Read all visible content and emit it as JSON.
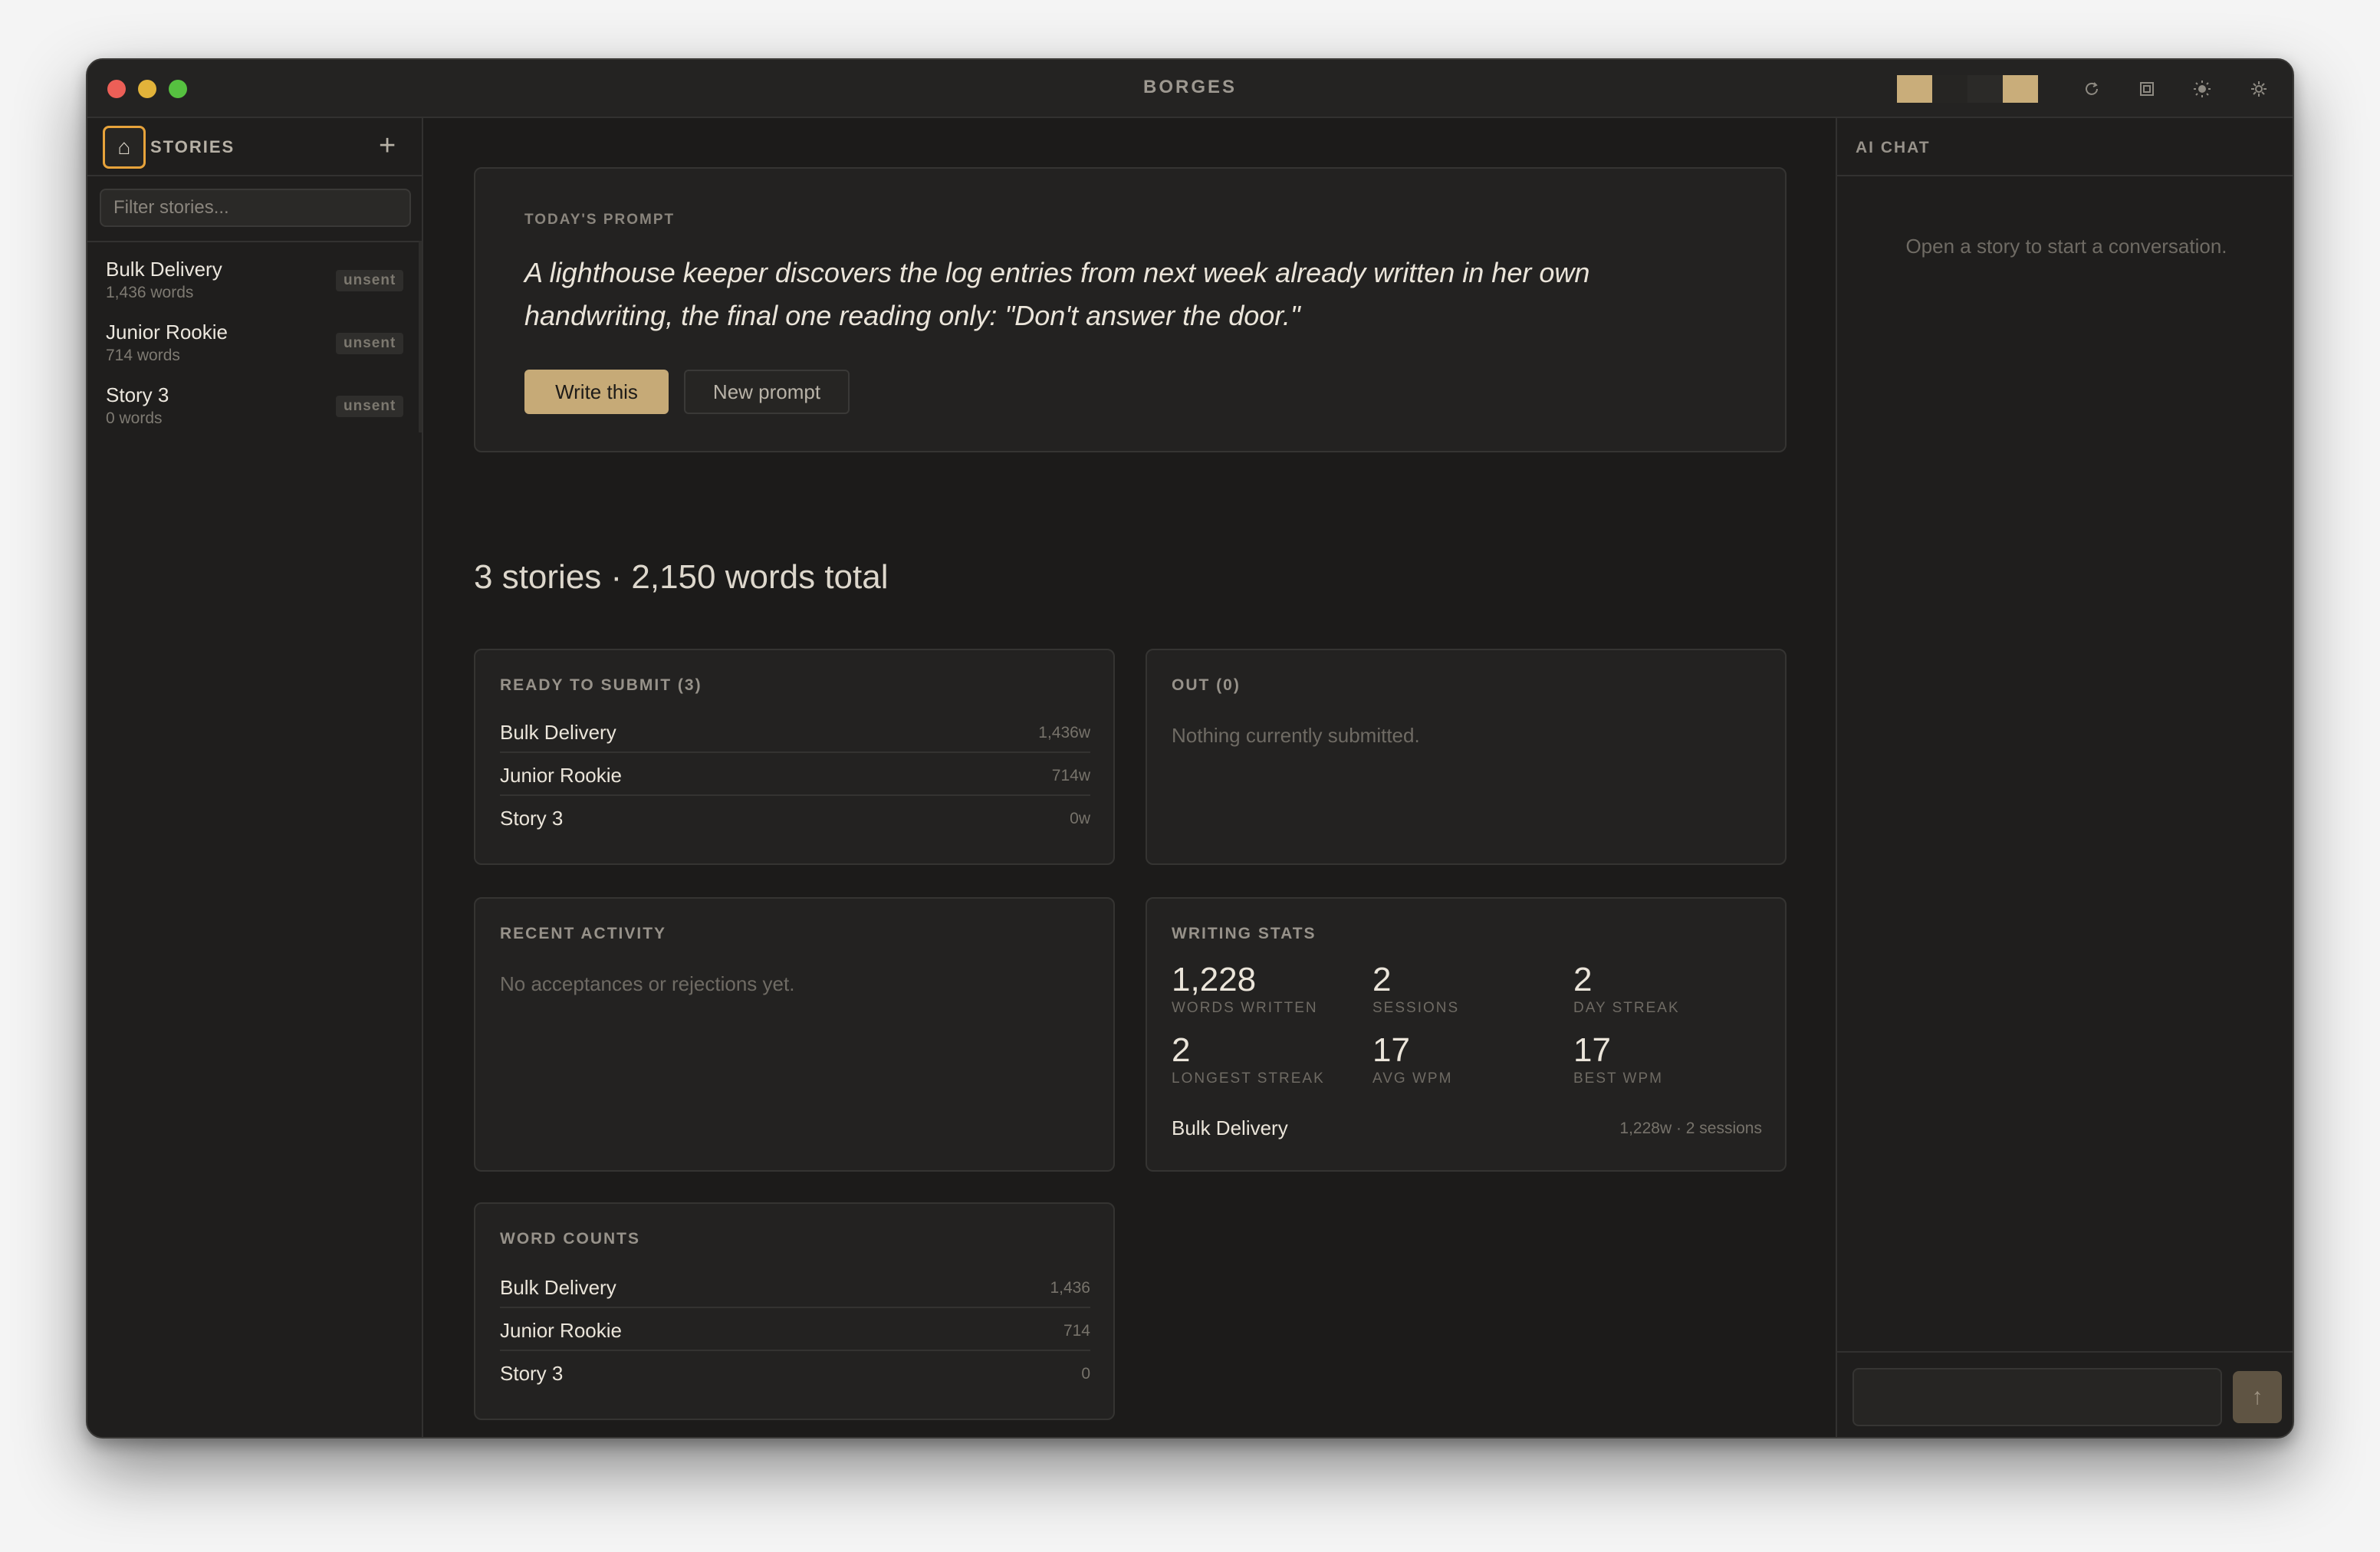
{
  "window": {
    "title": "BORGES",
    "swatch_colors": [
      "#c9ad7a",
      "#262523",
      "#2b2a28",
      "#c9ad7a"
    ],
    "icons": [
      "refresh-icon",
      "layout-icon",
      "sun-icon",
      "gear-icon"
    ]
  },
  "sidebar": {
    "home_icon": "⌂",
    "title": "STORIES",
    "add_label": "+",
    "filter_placeholder": "Filter stories...",
    "items": [
      {
        "name": "Bulk Delivery",
        "words": "1,436 words",
        "status": "unsent"
      },
      {
        "name": "Junior Rookie",
        "words": "714 words",
        "status": "unsent"
      },
      {
        "name": "Story 3",
        "words": "0 words",
        "status": "unsent"
      }
    ]
  },
  "main": {
    "prompt": {
      "label": "TODAY'S PROMPT",
      "text": "A lighthouse keeper discovers the log entries from next week already written in her own handwriting, the final one reading only: \"Don't answer the door.\"",
      "write_label": "Write this",
      "new_label": "New prompt"
    },
    "summary": "3 stories · 2,150 words total",
    "ready": {
      "label": "READY TO SUBMIT (3)",
      "rows": [
        {
          "name": "Bulk Delivery",
          "value": "1,436w"
        },
        {
          "name": "Junior Rookie",
          "value": "714w"
        },
        {
          "name": "Story 3",
          "value": "0w"
        }
      ]
    },
    "out": {
      "label": "OUT (0)",
      "empty": "Nothing currently submitted."
    },
    "activity": {
      "label": "RECENT ACTIVITY",
      "empty": "No acceptances or rejections yet."
    },
    "stats": {
      "label": "WRITING STATS",
      "items": [
        {
          "value": "1,228",
          "label": "WORDS WRITTEN"
        },
        {
          "value": "2",
          "label": "SESSIONS"
        },
        {
          "value": "2",
          "label": "DAY STREAK"
        },
        {
          "value": "2",
          "label": "LONGEST STREAK"
        },
        {
          "value": "17",
          "label": "AVG WPM"
        },
        {
          "value": "17",
          "label": "BEST WPM"
        }
      ],
      "story_name": "Bulk Delivery",
      "story_detail": "1,228w · 2 sessions"
    },
    "word_counts": {
      "label": "WORD COUNTS",
      "rows": [
        {
          "name": "Bulk Delivery",
          "value": "1,436"
        },
        {
          "name": "Junior Rookie",
          "value": "714"
        },
        {
          "name": "Story 3",
          "value": "0"
        }
      ]
    }
  },
  "chat": {
    "title": "AI CHAT",
    "empty": "Open a story to start a conversation.",
    "input_value": "",
    "send_icon": "↑"
  }
}
